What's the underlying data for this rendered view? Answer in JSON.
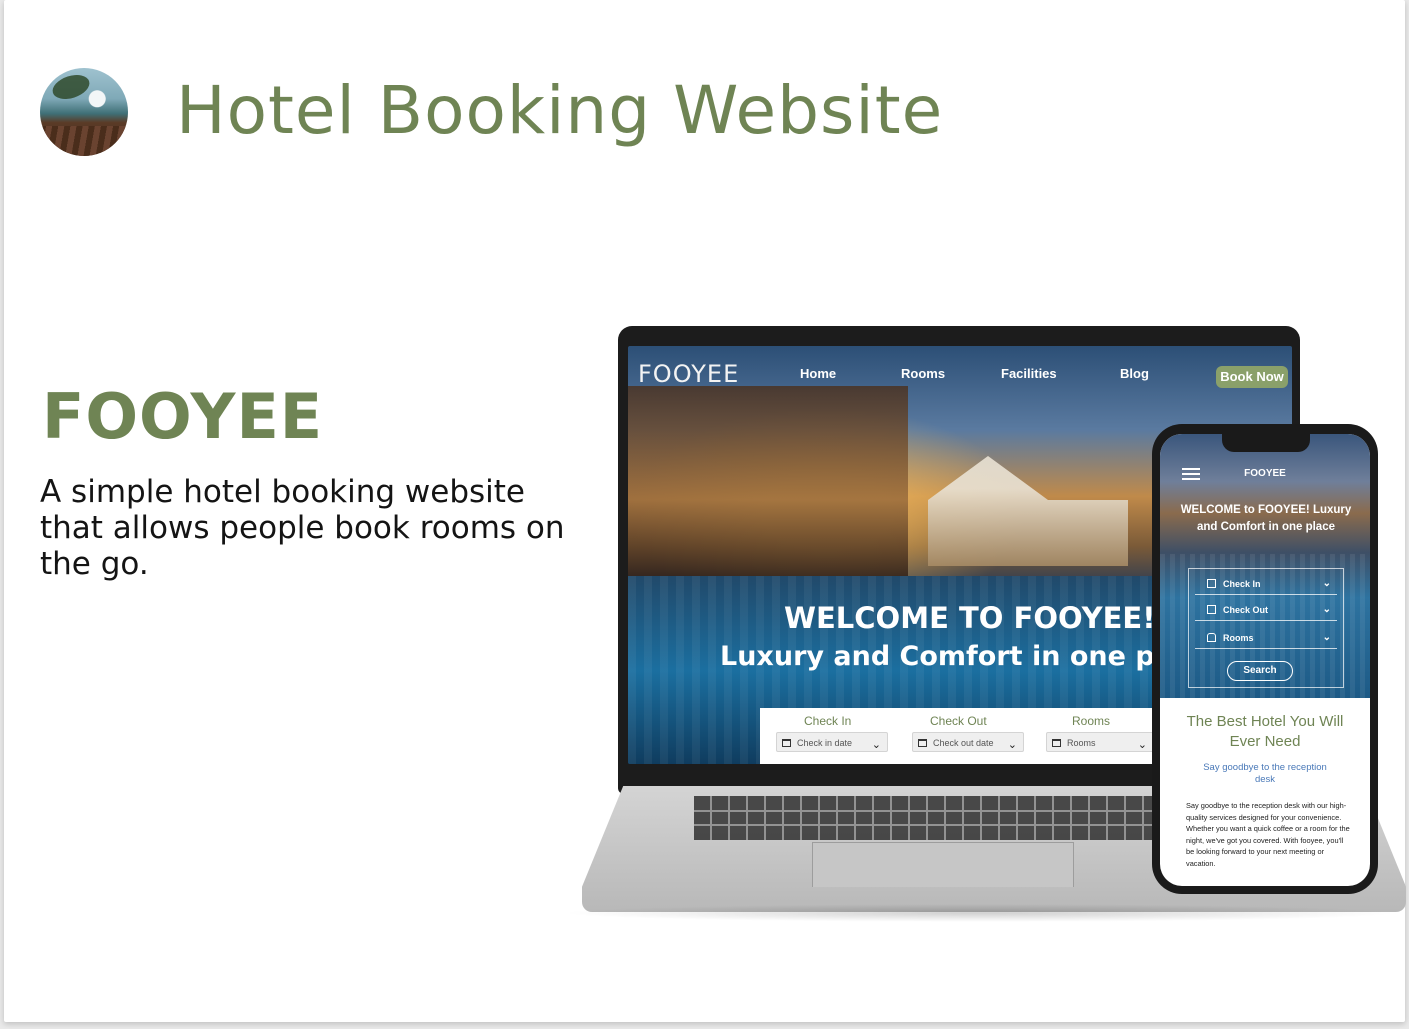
{
  "header": {
    "title": "Hotel Booking Website",
    "logo_icon": "beach-resort-avatar-icon"
  },
  "project": {
    "name": "FOOYEE",
    "description": "A simple hotel booking website that allows people book rooms on the go."
  },
  "colors": {
    "accent_green": "#6f8454",
    "button_green": "#8aa06a",
    "link_blue": "#4a79b8"
  },
  "desktop_site": {
    "logo": "FOOYEE",
    "nav": [
      "Home",
      "Rooms",
      "Facilities",
      "Blog"
    ],
    "cta": "Book Now",
    "welcome_line1": "WELCOME TO FOOYEE!",
    "welcome_line2": "Luxury and Comfort in one p",
    "booking": {
      "check_in_label": "Check In",
      "check_in_placeholder": "Check in date",
      "check_out_label": "Check Out",
      "check_out_placeholder": "Check out date",
      "rooms_label": "Rooms",
      "rooms_placeholder": "Rooms"
    }
  },
  "mobile_site": {
    "logo": "FOOYEE",
    "welcome": "WELCOME to FOOYEE! Luxury and Comfort in one place",
    "fields": [
      "Check In",
      "Check Out",
      "Rooms"
    ],
    "search": "Search",
    "heading": "The Best Hotel You Will Ever Need",
    "subheading": "Say goodbye to the reception desk",
    "body": "Say goodbye to the reception desk with our high-quality services designed for your convenience. Whether you want a quick coffee or a room for the night, we've got you covered. With fooyee, you'll be looking forward to your next meeting or vacation."
  }
}
